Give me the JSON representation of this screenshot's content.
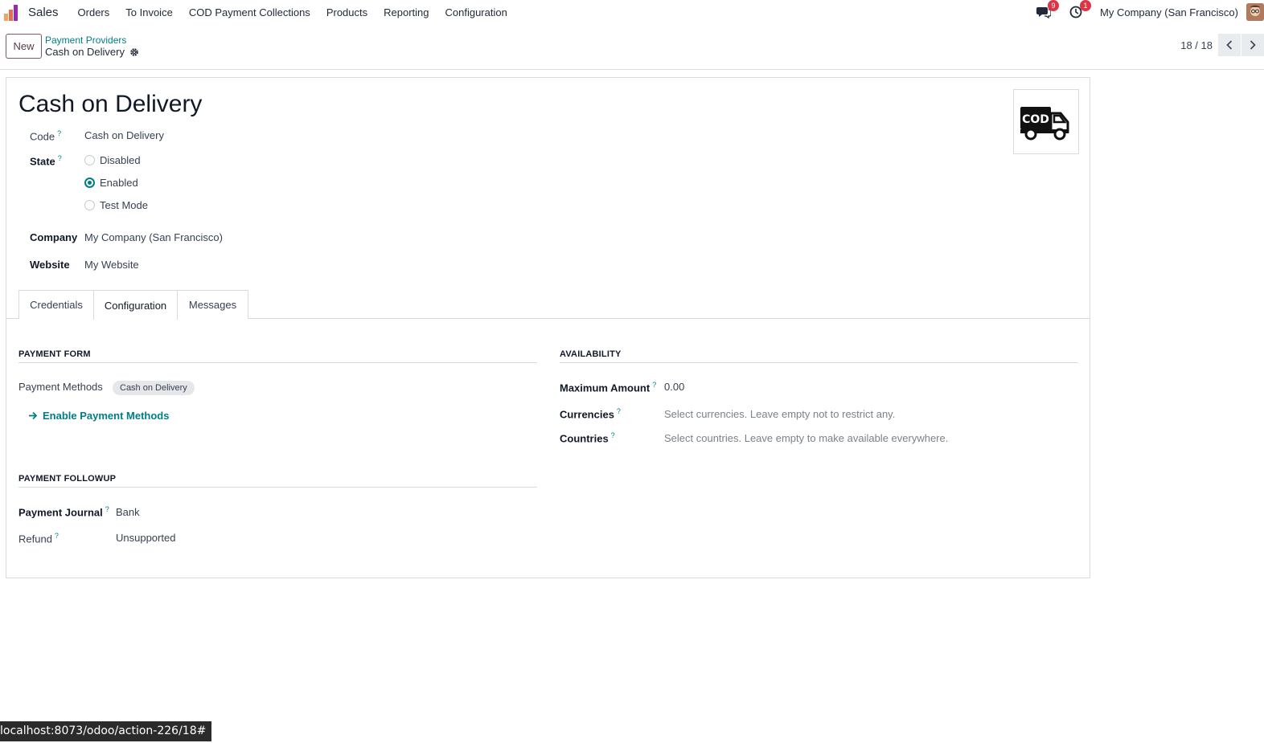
{
  "navbar": {
    "app_name": "Sales",
    "menu": [
      "Orders",
      "To Invoice",
      "COD Payment Collections",
      "Products",
      "Reporting",
      "Configuration"
    ],
    "messages_badge": "9",
    "activities_badge": "1",
    "company": "My Company (San Francisco)"
  },
  "control": {
    "new_label": "New",
    "breadcrumb_parent": "Payment Providers",
    "breadcrumb_current": "Cash on Delivery",
    "pager": "18 / 18"
  },
  "form": {
    "title": "Cash on Delivery",
    "logo_text": "COD",
    "code_label": "Code",
    "code_value": "Cash on Delivery",
    "state_label": "State",
    "state_options": [
      "Disabled",
      "Enabled",
      "Test Mode"
    ],
    "state_selected": "Enabled",
    "company_label": "Company",
    "company_value": "My Company (San Francisco)",
    "website_label": "Website",
    "website_value": "My Website"
  },
  "tabs": [
    "Credentials",
    "Configuration",
    "Messages"
  ],
  "active_tab": "Configuration",
  "payment_form": {
    "title": "PAYMENT FORM",
    "methods_label": "Payment Methods",
    "methods_tag": "Cash on Delivery",
    "enable_link": "Enable Payment Methods"
  },
  "availability": {
    "title": "AVAILABILITY",
    "max_amount_label": "Maximum Amount",
    "max_amount_value": "0.00",
    "currencies_label": "Currencies",
    "currencies_placeholder": "Select currencies. Leave empty not to restrict any.",
    "countries_label": "Countries",
    "countries_placeholder": "Select countries. Leave empty to make available everywhere."
  },
  "followup": {
    "title": "PAYMENT FOLLOWUP",
    "journal_label": "Payment Journal",
    "journal_value": "Bank",
    "refund_label": "Refund",
    "refund_value": "Unsupported"
  },
  "statusbar": "localhost:8073/odoo/action-226/18#",
  "colors": {
    "primary": "#017e84",
    "brand": "#714b67",
    "badge": "#dc3545"
  }
}
